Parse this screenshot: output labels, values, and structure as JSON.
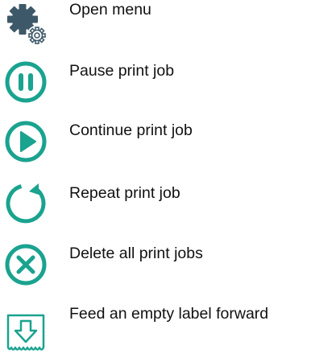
{
  "accent_color": "#1aa38f",
  "functions": [
    {
      "icon": "gear-settings-icon",
      "label": "Open menu"
    },
    {
      "icon": "pause-icon",
      "label": "Pause print job"
    },
    {
      "icon": "play-icon",
      "label": "Continue print job"
    },
    {
      "icon": "repeat-icon",
      "label": "Repeat print job"
    },
    {
      "icon": "delete-icon",
      "label": "Delete all print jobs"
    },
    {
      "icon": "feed-label-icon",
      "label": "Feed an empty label forward"
    }
  ]
}
